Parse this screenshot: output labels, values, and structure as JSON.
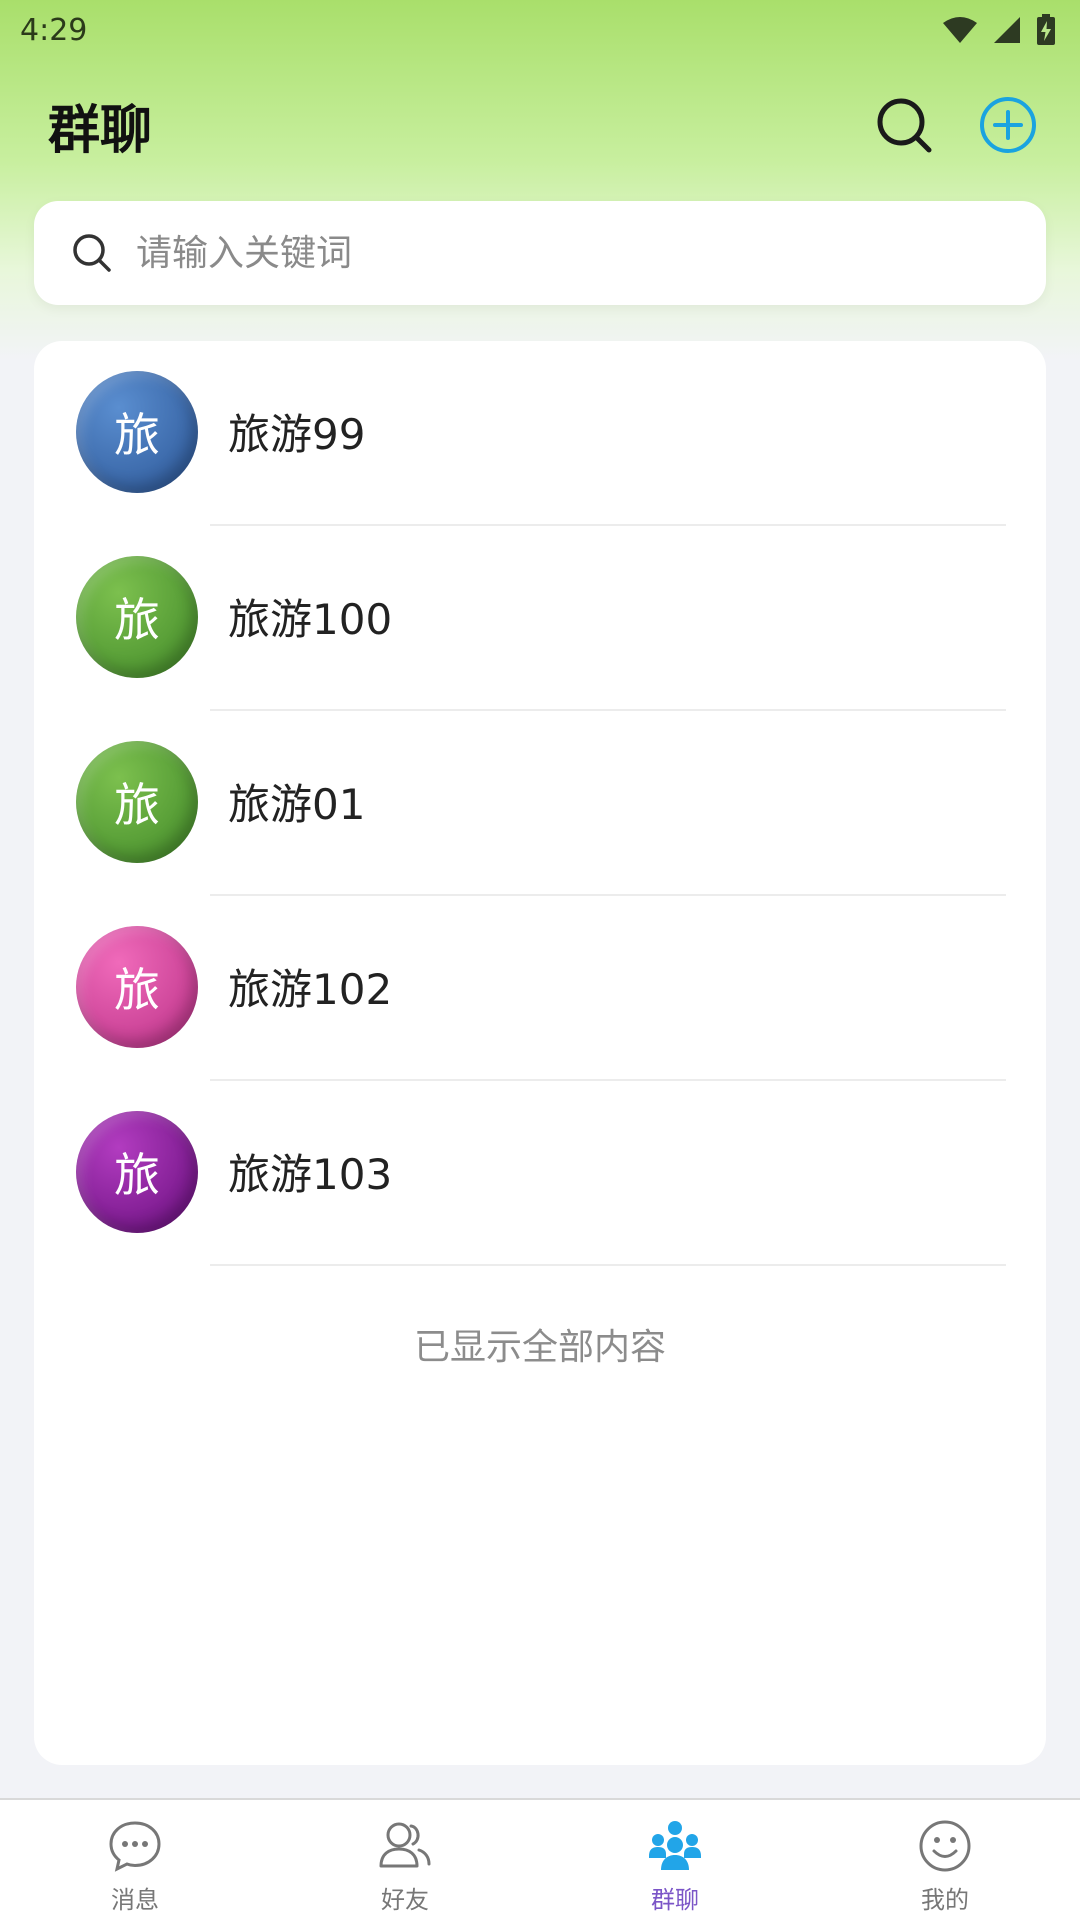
{
  "status_bar": {
    "time": "4:29"
  },
  "header": {
    "title": "群聊"
  },
  "search": {
    "placeholder": "请输入关键词"
  },
  "groups": [
    {
      "avatar_text": "旅",
      "name": "旅游99",
      "avatar_color_light": "#5a8ed0",
      "avatar_color_dark": "#2a5494"
    },
    {
      "avatar_text": "旅",
      "name": "旅游100",
      "avatar_color_light": "#7cc04e",
      "avatar_color_dark": "#3f8727"
    },
    {
      "avatar_text": "旅",
      "name": "旅游01",
      "avatar_color_light": "#7cc04e",
      "avatar_color_dark": "#3f8727"
    },
    {
      "avatar_text": "旅",
      "name": "旅游102",
      "avatar_color_light": "#f06aba",
      "avatar_color_dark": "#b82f85"
    },
    {
      "avatar_text": "旅",
      "name": "旅游103",
      "avatar_color_light": "#b23cc0",
      "avatar_color_dark": "#650d7a"
    }
  ],
  "list_end_text": "已显示全部内容",
  "tabs": [
    {
      "label": "消息",
      "icon": "chat-bubble-icon",
      "active": false
    },
    {
      "label": "好友",
      "icon": "friends-icon",
      "active": false
    },
    {
      "label": "群聊",
      "icon": "group-icon",
      "active": true
    },
    {
      "label": "我的",
      "icon": "smiley-icon",
      "active": false
    }
  ],
  "colors": {
    "accent_blue": "#1aa3e0",
    "active_tab": "#7b55c7",
    "header_green": "#a9df6b"
  }
}
